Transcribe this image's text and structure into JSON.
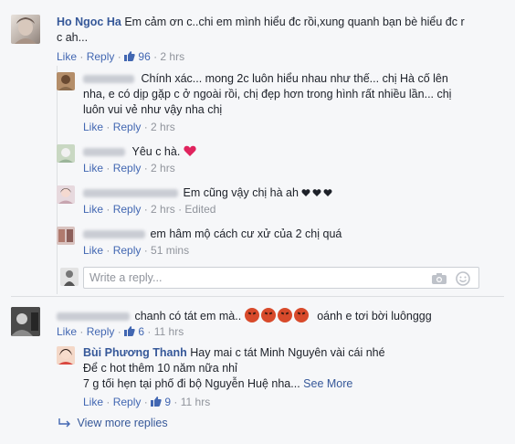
{
  "comments": [
    {
      "author": "Ho Ngoc Ha",
      "text_lines": [
        "Em cảm ơn c..chi em mình hiểu đc rồi,xung quanh bạn bè hiểu đc r",
        "c ah..."
      ],
      "actions": {
        "like": "Like",
        "reply": "Reply",
        "likes": "96",
        "time": "2 hrs"
      }
    },
    {
      "author": "",
      "text_lines": [
        "Chính xác... mong 2c luôn hiểu nhau như thế... chị Hà cố lên",
        "nha, e có dịp gặp c ở ngoài rồi, chị đẹp hơn trong hình rất nhiều lần... chị",
        "luôn vui vẻ như vậy nha chị"
      ],
      "actions": {
        "like": "Like",
        "reply": "Reply",
        "time": "2 hrs"
      }
    },
    {
      "author": "",
      "text": "Yêu c hà.",
      "actions": {
        "like": "Like",
        "reply": "Reply",
        "time": "2 hrs"
      }
    },
    {
      "author": "",
      "text": "Em cũng vậy chị hà ah",
      "actions": {
        "like": "Like",
        "reply": "Reply",
        "time": "2 hrs",
        "edited": "Edited"
      }
    },
    {
      "author": "",
      "text": "em hâm mộ cách cư xử của 2 chị quá",
      "actions": {
        "like": "Like",
        "reply": "Reply",
        "time": "51 mins"
      }
    },
    {
      "author": "",
      "text_before": "chanh có tát em mà..",
      "text_after": "oánh e tơi bời luônggg",
      "actions": {
        "like": "Like",
        "reply": "Reply",
        "likes": "6",
        "time": "11 hrs"
      }
    },
    {
      "author": "Bùi Phương Thanh",
      "text_lines": [
        "Hay mai c tát Minh Nguyên vài cái nhé",
        "Để c hot thêm 10 năm nữa nhỉ",
        "7 g tối hẹn tại phố đi bộ Nguyễn Huệ nha..."
      ],
      "see_more": "See More",
      "actions": {
        "like": "Like",
        "reply": "Reply",
        "likes": "9",
        "time": "11 hrs"
      }
    }
  ],
  "reply_box": {
    "placeholder": "Write a reply..."
  },
  "view_more": "View more replies",
  "colors": {
    "link": "#365899",
    "action": "#4267b2",
    "meta": "#90949c",
    "heart": "#e0245e"
  },
  "icons": [
    "camera-icon",
    "emoji-icon",
    "thumbs-up-icon",
    "heart-icon",
    "angry-face-icon",
    "reply-arrow-icon"
  ]
}
